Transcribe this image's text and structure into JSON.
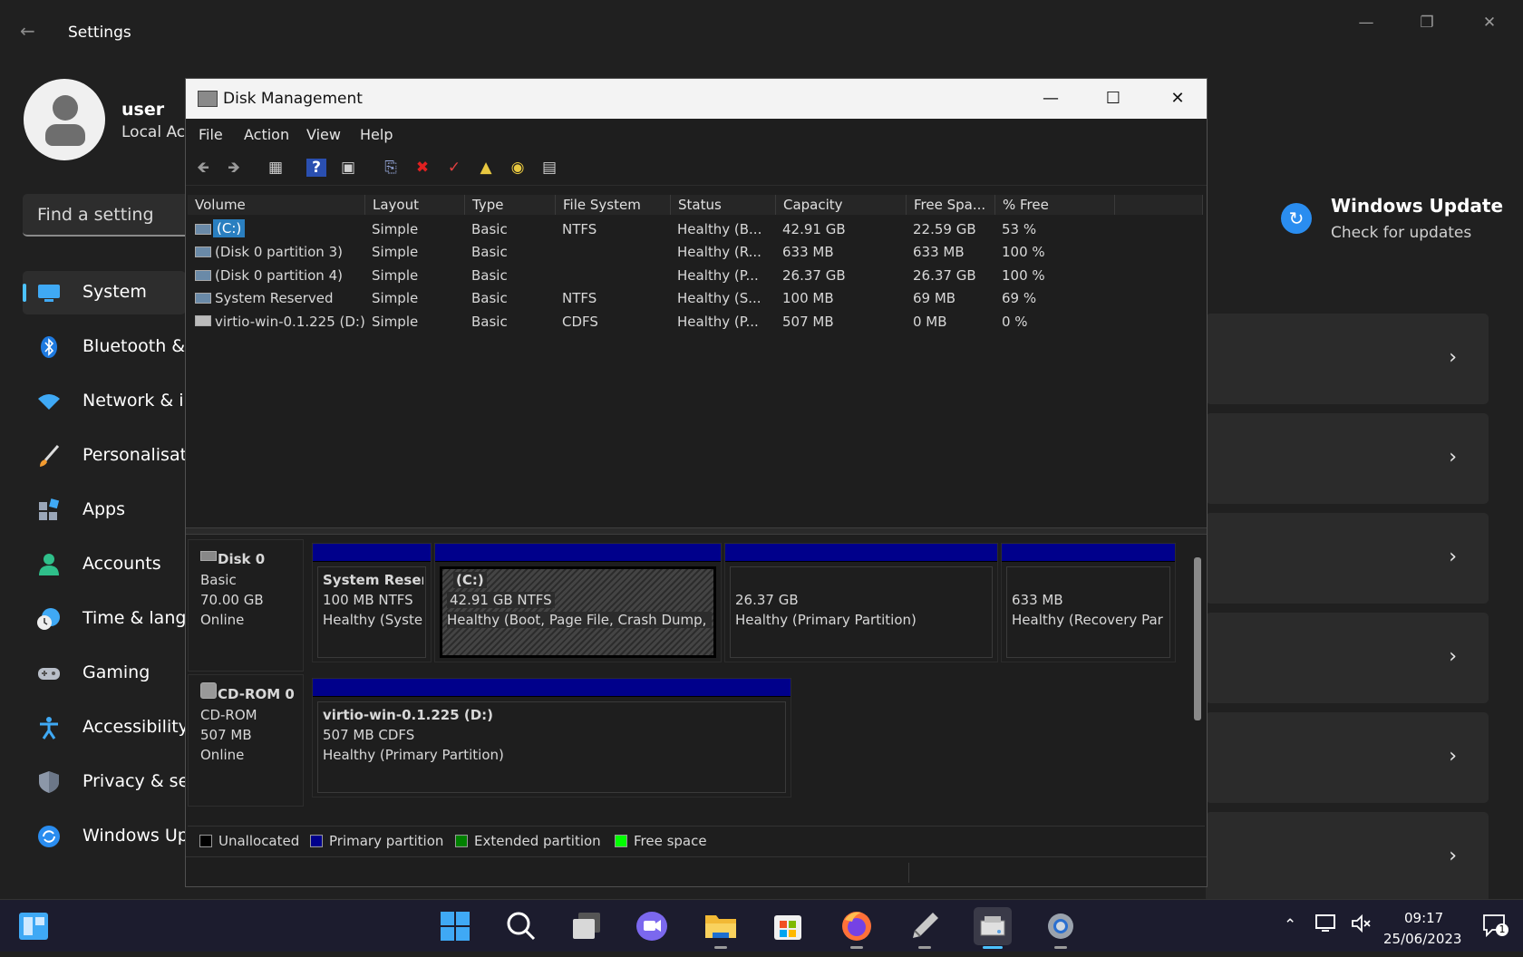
{
  "settings": {
    "title": "Settings",
    "back_glyph": "←",
    "user": {
      "name": "user",
      "account": "Local Ac"
    },
    "search_placeholder": "Find a setting",
    "nav": [
      {
        "label": "System",
        "icon": "monitor-icon"
      },
      {
        "label": "Bluetooth &",
        "icon": "bluetooth-icon"
      },
      {
        "label": "Network & i",
        "icon": "wifi-icon"
      },
      {
        "label": "Personalisati",
        "icon": "brush-icon"
      },
      {
        "label": "Apps",
        "icon": "apps-icon"
      },
      {
        "label": "Accounts",
        "icon": "person-icon"
      },
      {
        "label": "Time & lang",
        "icon": "clock-globe-icon"
      },
      {
        "label": "Gaming",
        "icon": "gamepad-icon"
      },
      {
        "label": "Accessibility",
        "icon": "accessibility-icon"
      },
      {
        "label": "Privacy & se",
        "icon": "shield-icon"
      },
      {
        "label": "Windows Up",
        "icon": "update-icon"
      }
    ],
    "windows_update": {
      "title": "Windows Update",
      "subtitle": "Check for updates"
    },
    "cards_chevron": "›"
  },
  "disk_management": {
    "title": "Disk Management",
    "menu": [
      "File",
      "Action",
      "View",
      "Help"
    ],
    "columns": [
      "Volume",
      "Layout",
      "Type",
      "File System",
      "Status",
      "Capacity",
      "Free Spa...",
      "% Free"
    ],
    "volumes": [
      {
        "volume": "(C:)",
        "layout": "Simple",
        "type": "Basic",
        "fs": "NTFS",
        "status": "Healthy (B...",
        "capacity": "42.91 GB",
        "free": "22.59 GB",
        "pct": "53 %"
      },
      {
        "volume": "(Disk 0 partition 3)",
        "layout": "Simple",
        "type": "Basic",
        "fs": "",
        "status": "Healthy (R...",
        "capacity": "633 MB",
        "free": "633 MB",
        "pct": "100 %"
      },
      {
        "volume": "(Disk 0 partition 4)",
        "layout": "Simple",
        "type": "Basic",
        "fs": "",
        "status": "Healthy (P...",
        "capacity": "26.37 GB",
        "free": "26.37 GB",
        "pct": "100 %"
      },
      {
        "volume": "System Reserved",
        "layout": "Simple",
        "type": "Basic",
        "fs": "NTFS",
        "status": "Healthy (S...",
        "capacity": "100 MB",
        "free": "69 MB",
        "pct": "69 %"
      },
      {
        "volume": "virtio-win-0.1.225 (D:)",
        "layout": "Simple",
        "type": "Basic",
        "fs": "CDFS",
        "status": "Healthy (P...",
        "capacity": "507 MB",
        "free": "0 MB",
        "pct": "0 %"
      }
    ],
    "disks": [
      {
        "name": "Disk 0",
        "type": "Basic",
        "size": "70.00 GB",
        "state": "Online",
        "partitions": [
          {
            "name": "System Reserv",
            "detail": "100 MB NTFS",
            "status": "Healthy (Syster"
          },
          {
            "name": "(C:)",
            "detail": "42.91 GB NTFS",
            "status": "Healthy (Boot, Page File, Crash Dump, P"
          },
          {
            "name": "",
            "detail": "26.37 GB",
            "status": "Healthy (Primary Partition)"
          },
          {
            "name": "",
            "detail": "633 MB",
            "status": "Healthy (Recovery Par"
          }
        ]
      },
      {
        "name": "CD-ROM 0",
        "type": "CD-ROM",
        "size": "507 MB",
        "state": "Online",
        "partitions": [
          {
            "name": "virtio-win-0.1.225  (D:)",
            "detail": "507 MB CDFS",
            "status": "Healthy (Primary Partition)"
          }
        ]
      }
    ],
    "legend": [
      {
        "label": "Unallocated",
        "color": "#000000"
      },
      {
        "label": "Primary partition",
        "color": "#00008b"
      },
      {
        "label": "Extended partition",
        "color": "#008000"
      },
      {
        "label": "Free space",
        "color": "#00ff00"
      }
    ]
  },
  "taskbar": {
    "apps": [
      "widgets-icon",
      "start-icon",
      "search-icon",
      "task-view-icon",
      "chat-icon",
      "file-explorer-icon",
      "store-icon",
      "firefox-icon",
      "pen-tool-icon",
      "disk-management-icon",
      "settings-gear-icon"
    ],
    "time": "09:17",
    "date": "25/06/2023",
    "notification_count": "1"
  }
}
